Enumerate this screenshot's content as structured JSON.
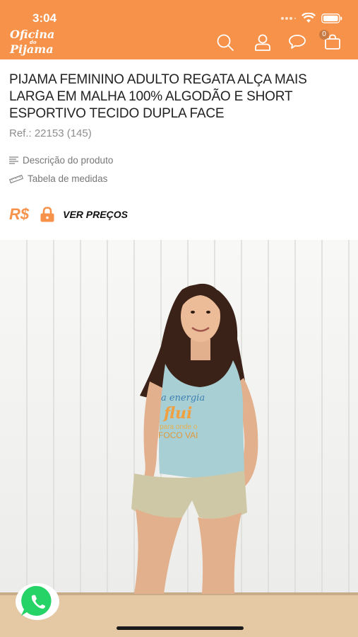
{
  "status_bar": {
    "time": "3:04"
  },
  "header": {
    "logo_line1": "Oficina",
    "logo_line2": "do",
    "logo_line3": "Pijama",
    "cart_count": "0",
    "brand_color": "#f7924a",
    "icons": [
      "search-icon",
      "user-icon",
      "chat-icon",
      "cart-icon"
    ]
  },
  "product": {
    "title": "PIJAMA FEMININO ADULTO REGATA ALÇA MAIS LARGA EM MALHA 100% ALGODÃO E SHORT ESPORTIVO TECIDO DUPLA FACE",
    "ref": "Ref.: 22153 (145)",
    "description_link": "Descrição do produto",
    "size_table_link": "Tabela de medidas",
    "currency": "R$",
    "see_prices": "VER PREÇOS"
  },
  "shirt_print": {
    "line1": "a energia",
    "line2": "flui",
    "line3": "para onde o",
    "line4": "FOCO VAI"
  }
}
